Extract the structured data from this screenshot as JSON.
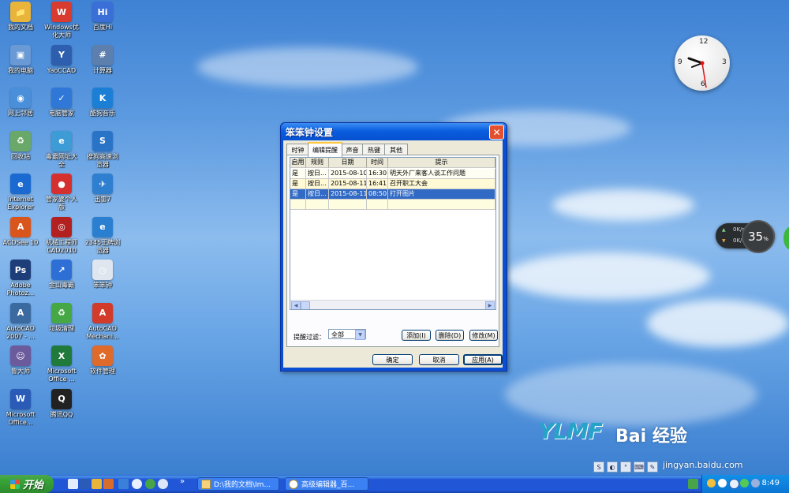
{
  "desktop_icons": [
    {
      "label": "我的文档",
      "glyph": "📁",
      "color": "#e8b43a"
    },
    {
      "label": "Windows优\n化大师",
      "glyph": "W",
      "color": "#d83b2f"
    },
    {
      "label": "百度Hi",
      "glyph": "Hi",
      "color": "#3a6fd8"
    },
    {
      "label": "我的电脑",
      "glyph": "▣",
      "color": "#6a9ad6"
    },
    {
      "label": "YaoCCAD",
      "glyph": "Y",
      "color": "#2e5fae"
    },
    {
      "label": "计算器",
      "glyph": "#",
      "color": "#5c7fae"
    },
    {
      "label": "网上邻居",
      "glyph": "◉",
      "color": "#4a8fd9"
    },
    {
      "label": "电脑管家",
      "glyph": "✓",
      "color": "#2f78d8"
    },
    {
      "label": "酷狗音乐",
      "glyph": "K",
      "color": "#1c7fd6"
    },
    {
      "label": "回收站",
      "glyph": "♻",
      "color": "#6aa86a"
    },
    {
      "label": "毒霸网址大\n全",
      "glyph": "e",
      "color": "#3d9bd6"
    },
    {
      "label": "搜狗高速浏\n览器",
      "glyph": "S",
      "color": "#2a74c8"
    },
    {
      "label": "Internet\nExplorer",
      "glyph": "e",
      "color": "#1b6ad1"
    },
    {
      "label": "管家婆个人\n版",
      "glyph": "●",
      "color": "#d43030"
    },
    {
      "label": "迅雷7",
      "glyph": "✈",
      "color": "#2f7fd1"
    },
    {
      "label": "ACDSee 10",
      "glyph": "A",
      "color": "#d9551c"
    },
    {
      "label": "机械工程师\nCAD2010",
      "glyph": "◎",
      "color": "#b32020"
    },
    {
      "label": "2345王牌浏\n览器",
      "glyph": "e",
      "color": "#2a7fd1"
    },
    {
      "label": "Adobe\nPhotoz...",
      "glyph": "Ps",
      "color": "#1e3e7a"
    },
    {
      "label": "金山毒霸",
      "glyph": "↗",
      "color": "#2e6fd6"
    },
    {
      "label": "笨笨钟",
      "glyph": "◷",
      "color": "#dfe6ef"
    },
    {
      "label": "AutoCAD\n2007 - ...",
      "glyph": "A",
      "color": "#3b6aa0"
    },
    {
      "label": "垃圾清理",
      "glyph": "♻",
      "color": "#45a845"
    },
    {
      "label": "AutoCAD\nMechani...",
      "glyph": "A",
      "color": "#d23a2a"
    },
    {
      "label": "鲁大师",
      "glyph": "☺",
      "color": "#6b5a9c"
    },
    {
      "label": "Microsoft\nOffice ...",
      "glyph": "X",
      "color": "#1f7a3c"
    },
    {
      "label": "软件管理",
      "glyph": "✿",
      "color": "#e06a2a"
    },
    {
      "label": "Microsoft\nOffice...",
      "glyph": "W",
      "color": "#2a5bb6"
    },
    {
      "label": "腾讯QQ",
      "glyph": "Q",
      "color": "#222"
    }
  ],
  "clock": {
    "n12": "12",
    "n3": "3",
    "n6": "6",
    "n9": "9"
  },
  "netmeter": {
    "up": "0K/s",
    "down": "0K/s",
    "percent": "35",
    "percent_sign": "%"
  },
  "dialog": {
    "title": "笨笨钟设置",
    "close": "✕",
    "tabs": [
      "时钟",
      "编辑提醒",
      "声音",
      "热键",
      "其他"
    ],
    "active_tab": "编辑提醒",
    "columns": [
      "启用",
      "规则",
      "日期",
      "时间",
      "提示"
    ],
    "rows": [
      [
        "是",
        "按日...",
        "2015-08-10",
        "16:30",
        "明天外厂来客人谈工作问题"
      ],
      [
        "是",
        "按日...",
        "2015-08-11",
        "16:41",
        "召开职工大会"
      ],
      [
        "是",
        "按日...",
        "2015-08-11",
        "08:50",
        "打开图片"
      ]
    ],
    "selected_row": 2,
    "filter_label": "提醒过滤：",
    "filter_value": "全部",
    "add_button": "添加(I)",
    "delete_button": "删除(D)",
    "edit_button": "修改(M)",
    "ok_button": "确定",
    "cancel_button": "取消",
    "apply_button": "应用(A)"
  },
  "watermark": {
    "brand": "YLMF",
    "baidu": "Bai 经验",
    "url": "jingyan.baidu.com"
  },
  "taskbar": {
    "start_label": "开始",
    "overflow": "»",
    "tasks": [
      "D:\\我的文档\\Im...",
      "高级编辑器_百..."
    ],
    "time": "8:49"
  }
}
